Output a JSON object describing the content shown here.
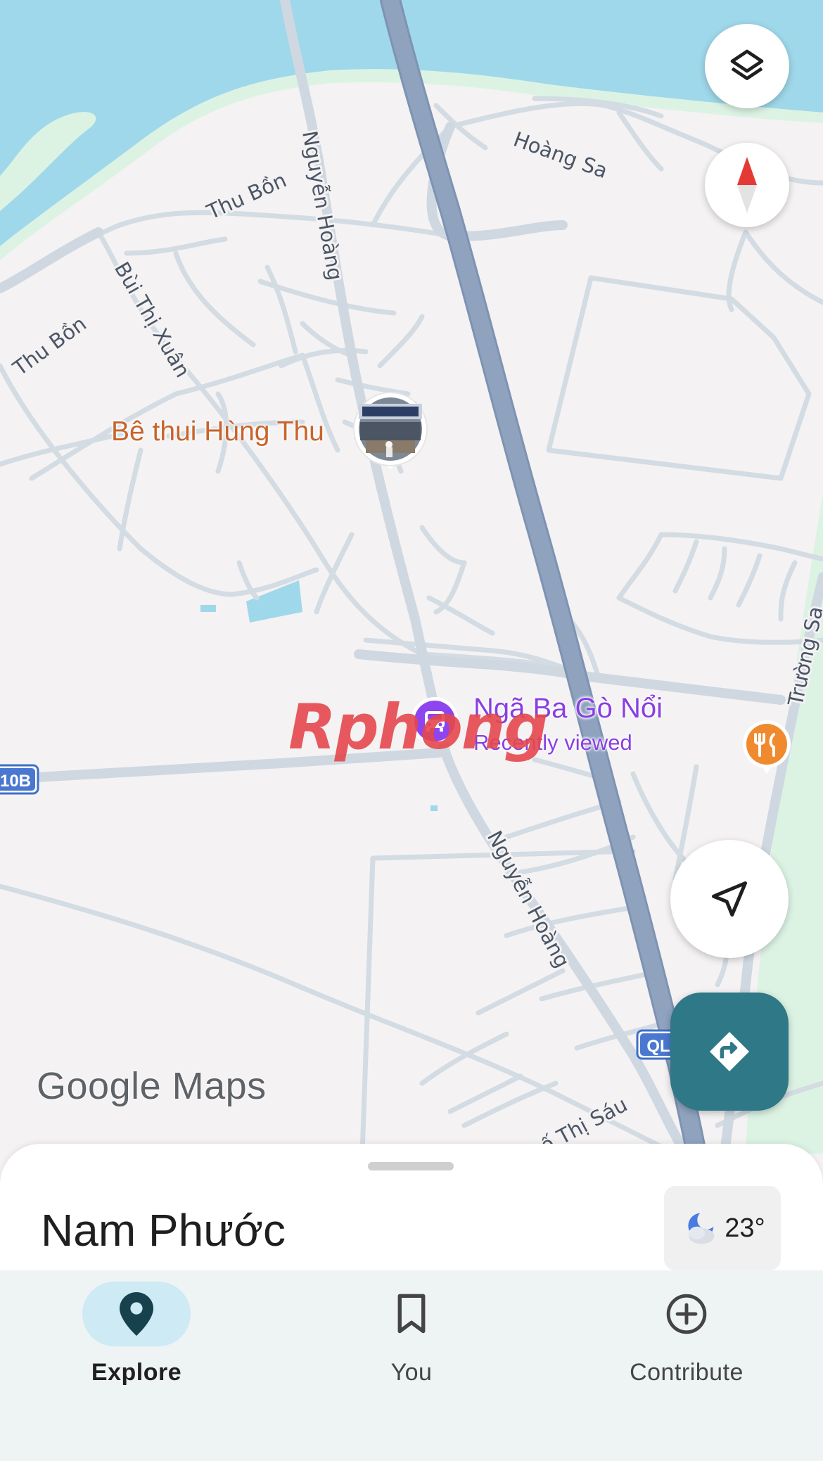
{
  "map": {
    "road_labels": {
      "nguyen_hoang_north": "Nguyễn Hoàng",
      "nguyen_hoang_south": "Nguyễn Hoàng",
      "thu_bon_1": "Thu Bồn",
      "thu_bon_2": "Thu Bồn",
      "bui_thi_xuan": "Bùi Thị Xuân",
      "hoang_sa": "Hoàng Sa",
      "truong_sa": "Trường Sa",
      "thi_sau": "ố Thị Sáu",
      "route_10b": "10B",
      "route_ql": "QL"
    },
    "places": {
      "be_thui": "Bê thui Hùng Thu",
      "nga_ba": "Ngã Ba Gò Nổi",
      "nga_ba_sub": "Recently viewed"
    },
    "watermark": "Rphong",
    "logo": "Google Maps"
  },
  "controls": {
    "layers_icon": "layers-icon",
    "compass_icon": "compass-icon",
    "location_icon": "navigation-arrow-icon",
    "directions_icon": "directions-icon"
  },
  "sheet": {
    "title": "Nam Phước",
    "temperature": "23°",
    "weather_icon": "partly-cloudy-night-icon"
  },
  "nav": {
    "items": [
      {
        "label": "Explore",
        "icon": "pin-icon",
        "active": true
      },
      {
        "label": "You",
        "icon": "bookmark-icon",
        "active": false
      },
      {
        "label": "Contribute",
        "icon": "add-circle-icon",
        "active": false
      }
    ]
  },
  "colors": {
    "water": "#9fd8ea",
    "park": "#dcf3e4",
    "highway": "#8fa3bf",
    "road": "#d3dbe3",
    "restaurant_pin": "#f08a2e",
    "transit_pin": "#8e44ef",
    "directions_fab": "#2f7887",
    "nav_active": "#cdeaf5"
  }
}
